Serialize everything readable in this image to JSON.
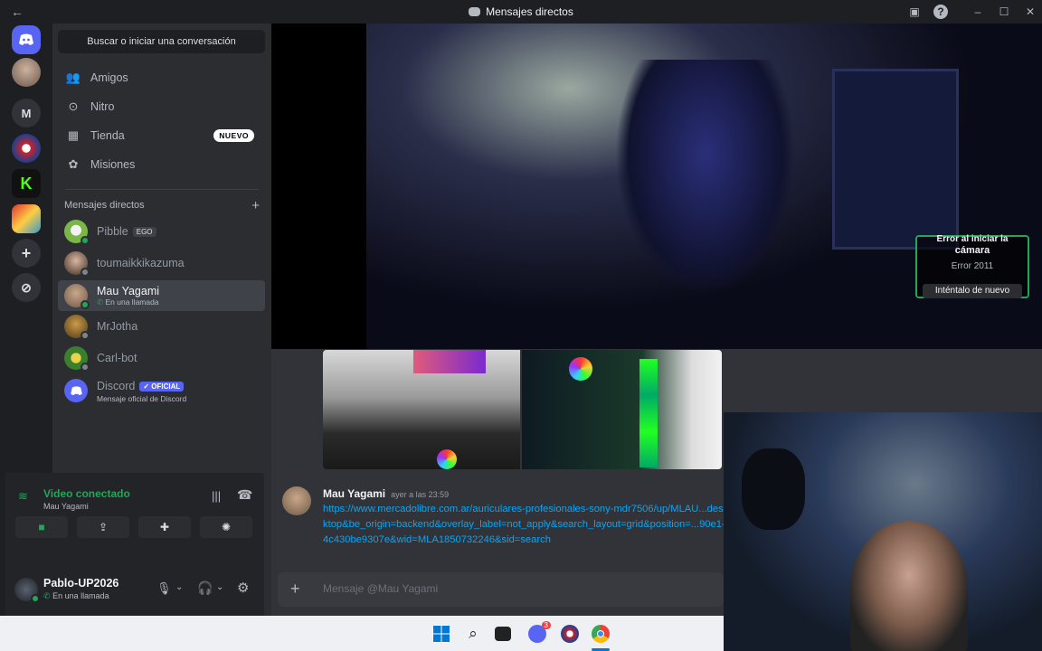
{
  "window": {
    "title": "Mensajes directos"
  },
  "guilds": [
    "M"
  ],
  "sidebar": {
    "search_label": "Buscar o iniciar una conversación",
    "nav": [
      {
        "label": "Amigos"
      },
      {
        "label": "Nitro"
      },
      {
        "label": "Tienda",
        "badge": "NUEVO"
      },
      {
        "label": "Misiones"
      }
    ],
    "dm_header": "Mensajes directos",
    "dms": [
      {
        "name": "Pibble",
        "tag": "EGO"
      },
      {
        "name": "toumaikkikazuma"
      },
      {
        "name": "Mau Yagami",
        "sub": "En una llamada"
      },
      {
        "name": "MrJotha"
      },
      {
        "name": "Carl-bot"
      },
      {
        "name": "Discord",
        "tag": "✓ OFICIAL",
        "sub": "Mensaje oficial de Discord"
      }
    ]
  },
  "voice": {
    "title": "Video conectado",
    "channel": "Mau Yagami"
  },
  "user": {
    "name": "Pablo-UP2026",
    "status": "En una llamada"
  },
  "camera_error": {
    "title_line1": "Error al iniciar la",
    "title_line2": "cámara",
    "code": "Error 2011",
    "retry": "Inténtalo de nuevo"
  },
  "message": {
    "author": "Mau Yagami",
    "time": "ayer a las 23:59",
    "link": "https://www.mercadolibre.com.ar/auriculares-profesionales-sony-mdr7506/up/MLAU...desktop&be_origin=backend&overlay_label=not_apply&search_layout=grid&position=...90e1-4c430be9307e&wid=MLA1850732246&sid=search"
  },
  "composer": {
    "placeholder": "Mensaje @Mau Yagami"
  },
  "taskbar": {
    "chrome_badge": "3"
  },
  "colors": {
    "accent": "#5865f2",
    "green": "#23a55a",
    "link": "#00a8fc"
  }
}
